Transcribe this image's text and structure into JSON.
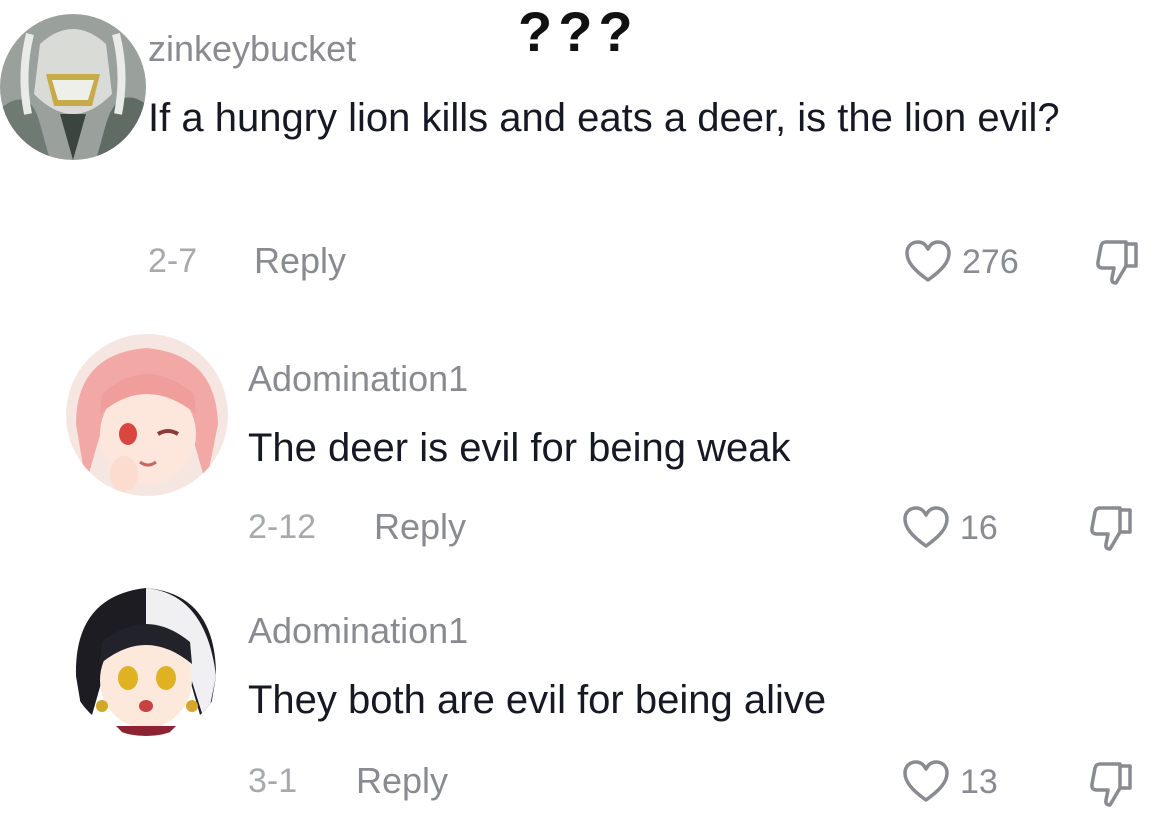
{
  "overlay_text": "???",
  "comments": [
    {
      "username": "zinkeybucket",
      "text": "If a hungry lion kills and eats a deer, is the lion evil?",
      "date": "2-7",
      "reply_label": "Reply",
      "likes": "276"
    },
    {
      "username": "Adomination1",
      "text": "The deer is evil for being weak",
      "date": "2-12",
      "reply_label": "Reply",
      "likes": "16"
    },
    {
      "username": "Adomination1",
      "text": "They both are evil for being alive",
      "date": "3-1",
      "reply_label": "Reply",
      "likes": "13"
    }
  ],
  "icons": {
    "like": "heart-outline-icon",
    "dislike": "thumbs-down-outline-icon"
  },
  "colors": {
    "text": "#161823",
    "secondary": "#8a8b91",
    "date": "#a8a9ad"
  }
}
